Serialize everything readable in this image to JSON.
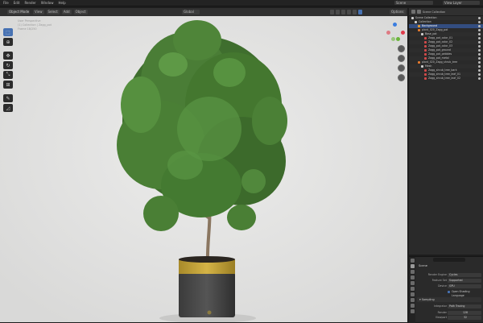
{
  "topbar": {
    "menus": [
      "File",
      "Edit",
      "Render",
      "Window",
      "Help"
    ],
    "scene": "Scene",
    "view_layer": "View Layer"
  },
  "viewport": {
    "mode": "Object Mode",
    "menus": [
      "View",
      "Select",
      "Add",
      "Object"
    ],
    "orientation": "Global",
    "options": "Options",
    "info": [
      "User Perspective",
      "(1) Collection | Zagg_pot",
      "Frame 18/250"
    ]
  },
  "outliner": {
    "title": "Scene Collection",
    "rows": [
      {
        "label": "Scene Collection",
        "indent": 0,
        "color": "#cfcfcf",
        "selected": false
      },
      {
        "label": "Collection",
        "indent": 1,
        "color": "#cfcfcf",
        "selected": false
      },
      {
        "label": "Background",
        "indent": 2,
        "color": "#e69a2e",
        "selected": true
      },
      {
        "label": "plant_020_Zagg_pot",
        "indent": 2,
        "color": "#e67a2e",
        "selected": false
      },
      {
        "label": "Base_pot",
        "indent": 3,
        "color": "#cfcfcf",
        "selected": false
      },
      {
        "label": "Zagg_pot_color_01",
        "indent": 4,
        "color": "#d04a4a",
        "selected": false
      },
      {
        "label": "Zagg_pot_color_02",
        "indent": 4,
        "color": "#d04a4a",
        "selected": false
      },
      {
        "label": "Zagg_pot_color_03",
        "indent": 4,
        "color": "#d04a4a",
        "selected": false
      },
      {
        "label": "Zagg_pot_ground",
        "indent": 4,
        "color": "#d04a4a",
        "selected": false
      },
      {
        "label": "Zagg_pot_pebbles",
        "indent": 4,
        "color": "#d04a4a",
        "selected": false
      },
      {
        "label": "Zagg_pot_metal",
        "indent": 4,
        "color": "#d04a4a",
        "selected": false
      },
      {
        "label": "plant_020_Zagg_shrub_tree",
        "indent": 2,
        "color": "#e67a2e",
        "selected": false
      },
      {
        "label": "Mesh",
        "indent": 3,
        "color": "#cfcfcf",
        "selected": false
      },
      {
        "label": "Zagg_shrub_tree_bark",
        "indent": 4,
        "color": "#d04a4a",
        "selected": false
      },
      {
        "label": "Zagg_shrub_tree_leaf_01",
        "indent": 4,
        "color": "#d04a4a",
        "selected": false
      },
      {
        "label": "Zagg_shrub_tree_leaf_02",
        "indent": 4,
        "color": "#d04a4a",
        "selected": false
      }
    ]
  },
  "properties": {
    "title": "Scene",
    "fields": [
      {
        "label": "Render Engine",
        "value": "Cycles"
      },
      {
        "label": "Feature Set",
        "value": "Supported"
      },
      {
        "label": "Device",
        "value": "GPU"
      }
    ],
    "checkbox": "Open Shading Language",
    "section": "Sampling",
    "integrator_label": "Integrator",
    "integrator": "Path Tracing",
    "render_label": "Render",
    "render_value": "128",
    "viewport_label": "Viewport",
    "viewport_value": "32"
  }
}
